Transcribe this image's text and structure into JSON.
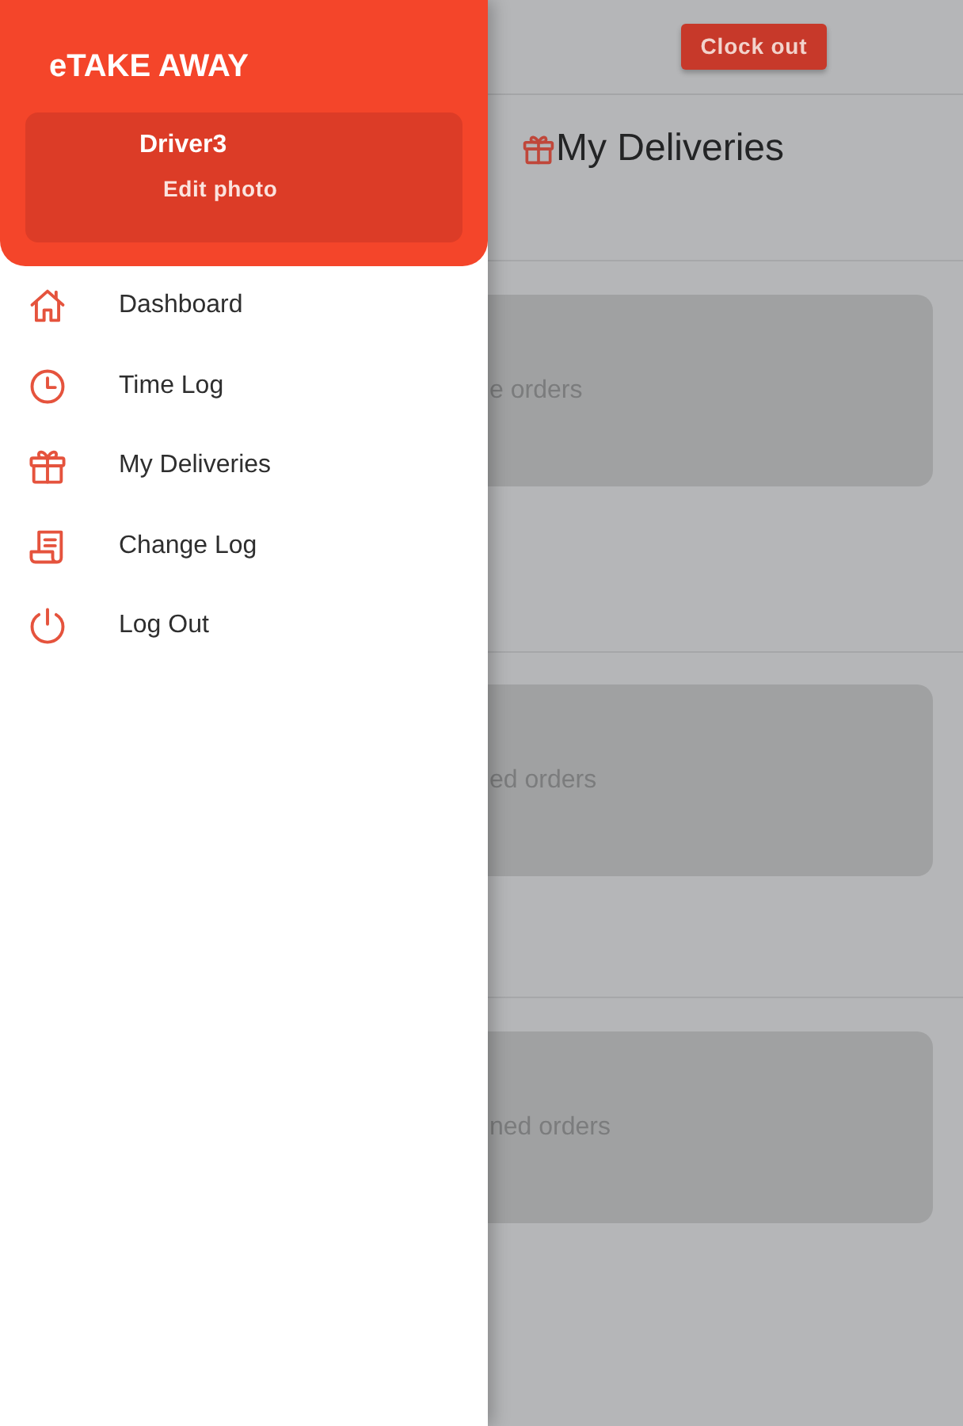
{
  "drawer": {
    "title": "eTAKE AWAY",
    "profile": {
      "name": "Driver3",
      "action": "Edit photo"
    },
    "items": [
      {
        "label": "Dashboard",
        "kind": "home"
      },
      {
        "label": "Time Log",
        "kind": "clock"
      },
      {
        "label": "My Deliveries",
        "kind": "gift"
      },
      {
        "label": "Change Log",
        "kind": "scroll"
      },
      {
        "label": "Log Out",
        "kind": "power"
      }
    ]
  },
  "top_bar": {
    "button": "Clock out"
  },
  "page": {
    "title": "My Deliveries",
    "sections": [
      {
        "text": "e orders"
      },
      {
        "text": "ed orders"
      },
      {
        "text": "ned orders"
      }
    ]
  }
}
